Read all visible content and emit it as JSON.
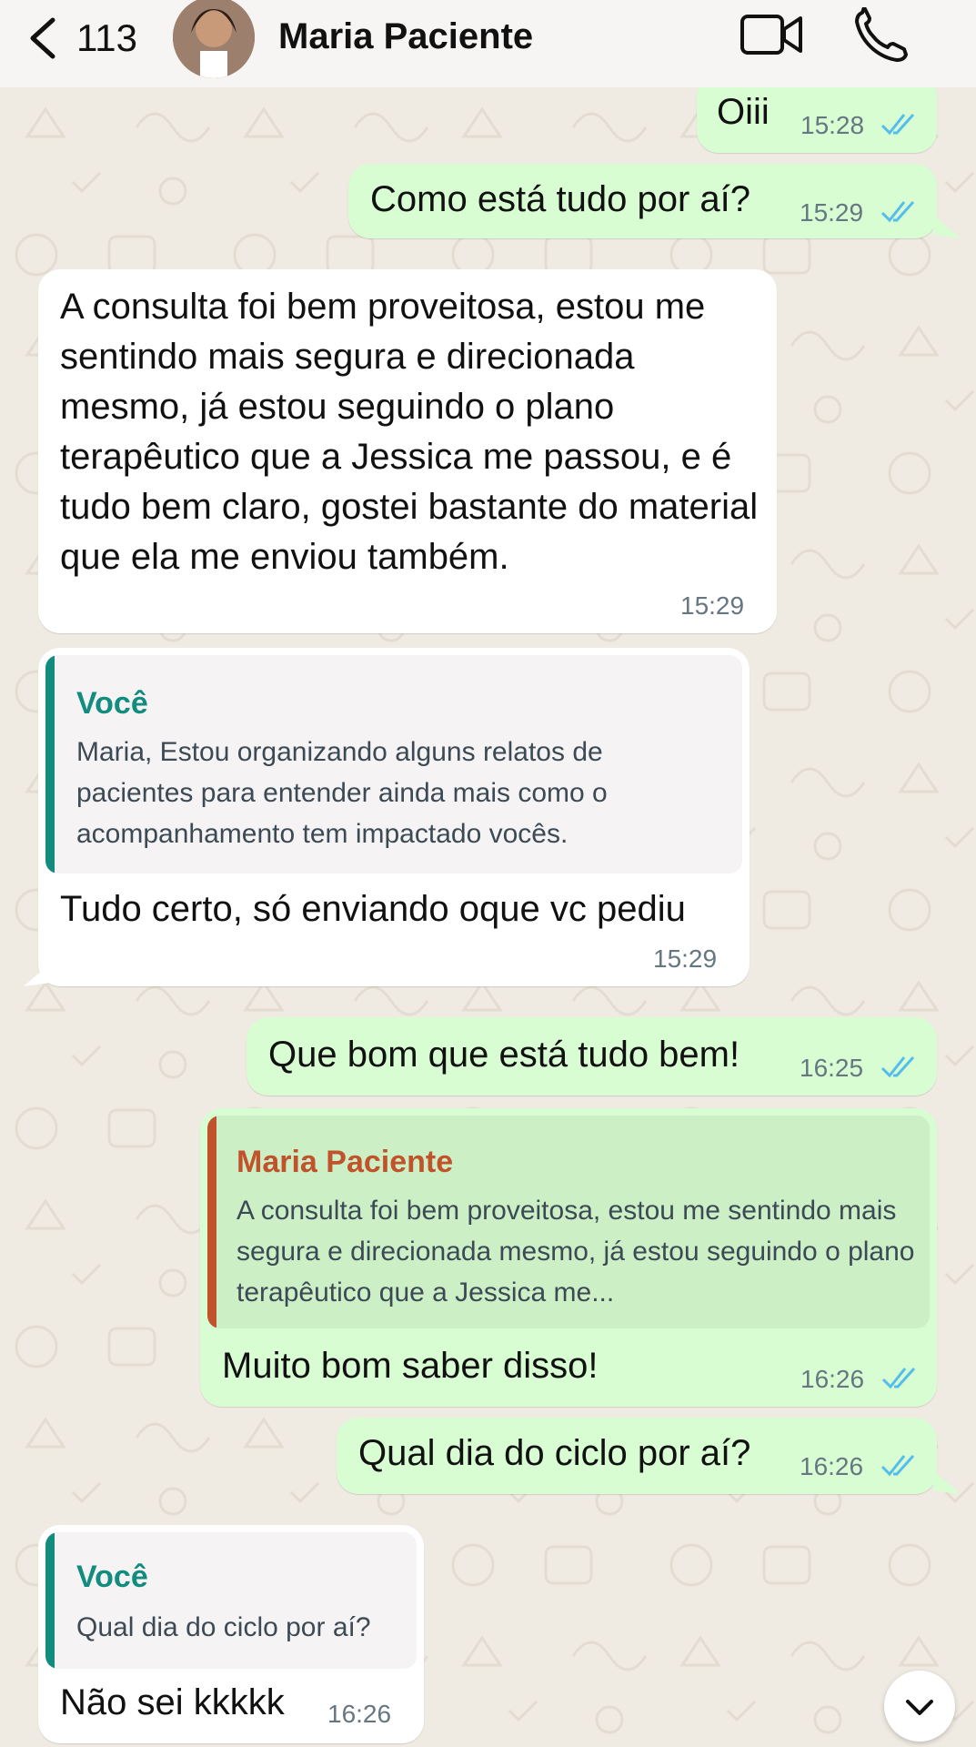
{
  "header": {
    "back_count": "113",
    "contact_name": "Maria Paciente"
  },
  "messages": [
    {
      "text": "Oiii",
      "time": "15:28"
    },
    {
      "text": "Como está tudo por aí?",
      "time": "15:29"
    },
    {
      "text": "A consulta foi bem proveitosa, estou me sentindo mais segura e direcionada mesmo, já estou seguindo o plano terapêutico que a Jessica me passou, e é tudo bem claro, gostei bastante do material que ela me enviou também.",
      "time": "15:29"
    },
    {
      "quote_author": "Você",
      "quote_text": "Maria, Estou organizando alguns relatos de pacientes para entender ainda mais como o acompanhamento tem impactado vocês.",
      "text": "Tudo certo, só enviando oque vc pediu",
      "time": "15:29"
    },
    {
      "text": "Que bom que está tudo bem!",
      "time": "16:25"
    },
    {
      "quote_author": "Maria Paciente",
      "quote_text": "A consulta foi bem proveitosa, estou me sentindo mais segura e direcionada mesmo, já estou seguindo o plano terapêutico que a Jessica me...",
      "text": "Muito bom saber disso!",
      "time": "16:26"
    },
    {
      "text": "Qual dia do ciclo por aí?",
      "time": "16:26"
    },
    {
      "quote_author": "Você",
      "quote_text": "Qual dia do ciclo por aí?",
      "text": "Não sei kkkkk",
      "time": "16:26"
    }
  ],
  "colors": {
    "outgoing_bubble": "#d9fdd3",
    "incoming_bubble": "#ffffff",
    "read_ticks": "#53bdeb",
    "quote_you": "#128c7e",
    "quote_contact": "#c0532b"
  },
  "icons": [
    "chevron-left-icon",
    "video-camera-icon",
    "phone-icon",
    "double-check-icon",
    "chevron-down-icon"
  ]
}
